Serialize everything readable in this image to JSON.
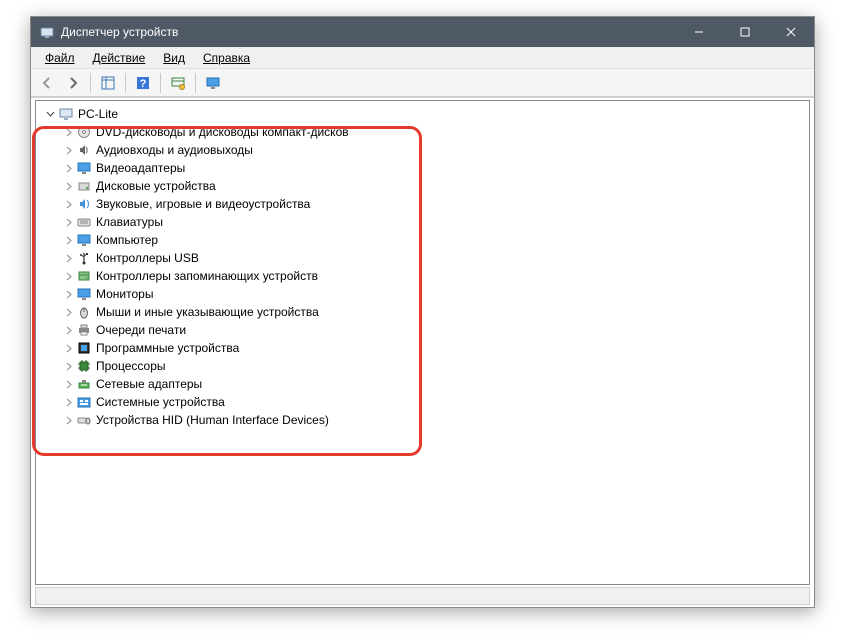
{
  "window": {
    "title": "Диспетчер устройств"
  },
  "menu": {
    "file": "Файл",
    "action": "Действие",
    "view": "Вид",
    "help": "Справка"
  },
  "tree": {
    "root": "PC-Lite",
    "items": [
      {
        "label": "DVD-дисководы и дисководы компакт-дисков",
        "icon": "disc"
      },
      {
        "label": "Аудиовходы и аудиовыходы",
        "icon": "audio"
      },
      {
        "label": "Видеоадаптеры",
        "icon": "display"
      },
      {
        "label": "Дисковые устройства",
        "icon": "drive"
      },
      {
        "label": "Звуковые, игровые и видеоустройства",
        "icon": "sound"
      },
      {
        "label": "Клавиатуры",
        "icon": "keyboard"
      },
      {
        "label": "Компьютер",
        "icon": "computer"
      },
      {
        "label": "Контроллеры USB",
        "icon": "usb"
      },
      {
        "label": "Контроллеры запоминающих устройств",
        "icon": "storage"
      },
      {
        "label": "Мониторы",
        "icon": "monitor"
      },
      {
        "label": "Мыши и иные указывающие устройства",
        "icon": "mouse"
      },
      {
        "label": "Очереди печати",
        "icon": "printer"
      },
      {
        "label": "Программные устройства",
        "icon": "software"
      },
      {
        "label": "Процессоры",
        "icon": "cpu"
      },
      {
        "label": "Сетевые адаптеры",
        "icon": "network"
      },
      {
        "label": "Системные устройства",
        "icon": "system"
      },
      {
        "label": "Устройства HID (Human Interface Devices)",
        "icon": "hid"
      }
    ]
  }
}
